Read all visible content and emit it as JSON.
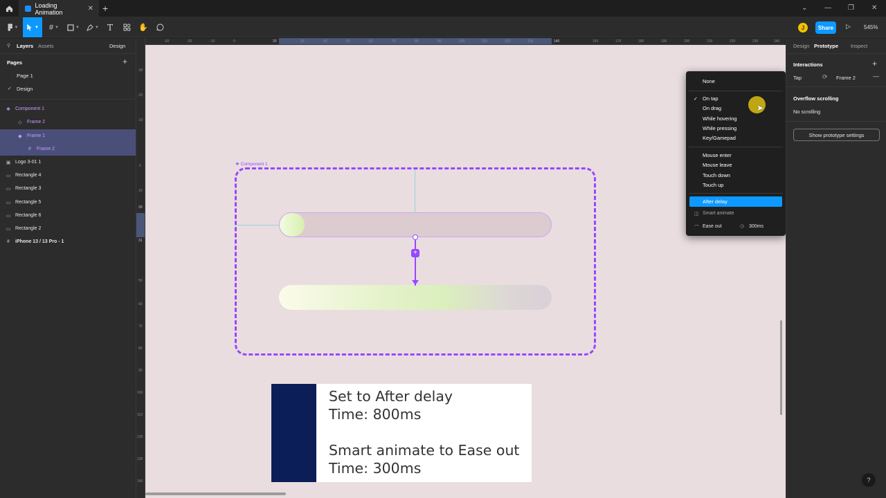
{
  "titlebar": {
    "tab_title": "Loading Animation",
    "close": "✕",
    "new_tab": "+",
    "win_chevron": "⌄",
    "win_minimize": "—",
    "win_restore": "❐",
    "win_close": "✕"
  },
  "toolbar": {
    "avatar_initial": "J",
    "share_label": "Share",
    "zoom": "545%"
  },
  "left_panel": {
    "tab_layers": "Layers",
    "tab_assets": "Assets",
    "mode": "Design",
    "pages_heading": "Pages",
    "pages": [
      "Page 1",
      "Design"
    ],
    "layers": [
      {
        "icon": "component-icon",
        "label": "Component 1"
      },
      {
        "icon": "variant-icon",
        "label": "Frame 2"
      },
      {
        "icon": "variant-icon",
        "label": "Frame 1"
      },
      {
        "icon": "frame-icon",
        "label": "Frame 2"
      },
      {
        "icon": "frame-icon",
        "label": "Logo 3-01 1"
      },
      {
        "icon": "rectangle-icon",
        "label": "Rectangle 4"
      },
      {
        "icon": "rectangle-icon",
        "label": "Rectangle 3"
      },
      {
        "icon": "rectangle-icon",
        "label": "Rectangle 5"
      },
      {
        "icon": "rectangle-icon",
        "label": "Rectangle 6"
      },
      {
        "icon": "rectangle-icon",
        "label": "Rectangle 2"
      },
      {
        "icon": "frame-icon",
        "label": "iPhone 13 / 13 Pro - 1"
      }
    ]
  },
  "ruler": {
    "top_ticks": [
      "-30",
      "-20",
      "-10",
      "0",
      "20",
      "30",
      "40",
      "50",
      "60",
      "70",
      "80",
      "90",
      "100",
      "110",
      "120",
      "130",
      "140",
      "160",
      "170",
      "180",
      "190",
      "200",
      "210",
      "220",
      "230",
      "240"
    ],
    "left_ticks": [
      "-30",
      "-20",
      "-10",
      "0",
      "10",
      "20",
      "31",
      "50",
      "60",
      "70",
      "80",
      "90",
      "100",
      "110",
      "120",
      "130",
      "140"
    ]
  },
  "canvas": {
    "component_label": "Component 1",
    "note_lines": [
      "Set to After delay",
      "Time: 800ms",
      "Smart animate to Ease out",
      "Time: 300ms"
    ],
    "background_color": "#e9dde0",
    "accent_color": "#9747ff"
  },
  "dropdown": {
    "items_top": [
      "None"
    ],
    "items_group1": [
      "On tap",
      "On drag",
      "While hovering",
      "While pressing",
      "Key/Gamepad"
    ],
    "items_group2": [
      "Mouse enter",
      "Mouse leave",
      "Touch down",
      "Touch up"
    ],
    "selected": "After delay",
    "animation": "Smart animate",
    "easing": "Ease out",
    "duration": "300ms"
  },
  "right_panel": {
    "tabs": [
      "Design",
      "Prototype",
      "Inspect"
    ],
    "interactions_heading": "Interactions",
    "interaction_trigger": "Tap",
    "interaction_target": "Frame 2",
    "overflow_heading": "Overflow scrolling",
    "overflow_value": "No scrolling",
    "prototype_settings_button": "Show prototype settings",
    "help": "?"
  }
}
